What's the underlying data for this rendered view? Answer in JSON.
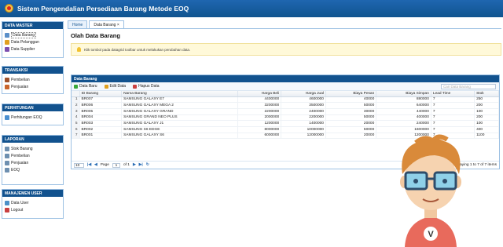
{
  "app": {
    "title": "Sistem Pengendalian Persediaan Barang Metode EOQ"
  },
  "sidebar": {
    "panels": [
      {
        "title": "DATA MASTER",
        "items": [
          "Data Barang",
          "Data Pelanggan",
          "Data Supplier"
        ]
      },
      {
        "title": "TRANSAKSI",
        "items": [
          "Pembelian",
          "Penjualan"
        ]
      },
      {
        "title": "PERHITUNGAN",
        "items": [
          "Perhitungan EOQ"
        ]
      },
      {
        "title": "LAPORAN",
        "items": [
          "Stok Barang",
          "Pembelian",
          "Penjualan",
          "EOQ"
        ]
      },
      {
        "title": "MANAJEMEN USER",
        "items": [
          "Data User",
          "Logout"
        ]
      }
    ]
  },
  "tabs": {
    "home": "Home",
    "active": "Data Barang",
    "close": "×"
  },
  "page": {
    "title": "Olah Data Barang",
    "info": "Klik tombol pada datagrid toolbar untuk melakukan perubahan data."
  },
  "grid": {
    "title": "Data Barang",
    "toolbar": {
      "new": "Data Baru",
      "edit": "Edit Data",
      "delete": "Hapus Data"
    },
    "search_placeholder": "Cari Data Barang",
    "columns": [
      "ID Barang",
      "Nama Barang",
      "Harga Beli",
      "Harga Jual",
      "Biaya Pesan",
      "Biaya Simpan",
      "Lead Time",
      "Stok"
    ],
    "rows": [
      [
        "1",
        "BR007",
        "SAMSUNG GALAXY E7",
        "4400000",
        "4600000",
        "40000",
        "880000",
        "7",
        "250"
      ],
      [
        "2",
        "BR006",
        "SAMSUNG GALAXY MEGA 2",
        "3200000",
        "3500000",
        "50000",
        "640000",
        "7",
        "200"
      ],
      [
        "3",
        "BR005",
        "SAMSUNG GALAXY GRAND",
        "2200000",
        "2400000",
        "30000",
        "440000",
        "7",
        "100"
      ],
      [
        "4",
        "BR004",
        "SAMSUNG GRAND NEO PLUS",
        "2000000",
        "2200000",
        "50000",
        "400000",
        "7",
        "200"
      ],
      [
        "5",
        "BR003",
        "SAMSUNG GALAXY J1",
        "1200000",
        "1400000",
        "20000",
        "240000",
        "7",
        "100"
      ],
      [
        "6",
        "BR002",
        "SAMSUNG S6 EDGE",
        "8000000",
        "10000000",
        "50000",
        "1600000",
        "7",
        "400"
      ],
      [
        "7",
        "BR001",
        "SAMSUNG GALAXY S6",
        "6000000",
        "12000000",
        "20000",
        "1200000",
        "7",
        "1100"
      ]
    ],
    "pager": {
      "page_size": "10",
      "page_label": "Page",
      "page": "1",
      "of": "of 1",
      "display": "Displaying 1 to 7 of 7 items"
    }
  },
  "colors": {
    "header": "#12528e",
    "accent": "#2c6fb6",
    "info_bg": "#fff9d9"
  },
  "icons": [
    "app-logo-icon",
    "bulb-icon",
    "add-icon",
    "edit-icon",
    "delete-icon",
    "first-page-icon",
    "prev-page-icon",
    "next-page-icon",
    "last-page-icon",
    "refresh-icon"
  ]
}
